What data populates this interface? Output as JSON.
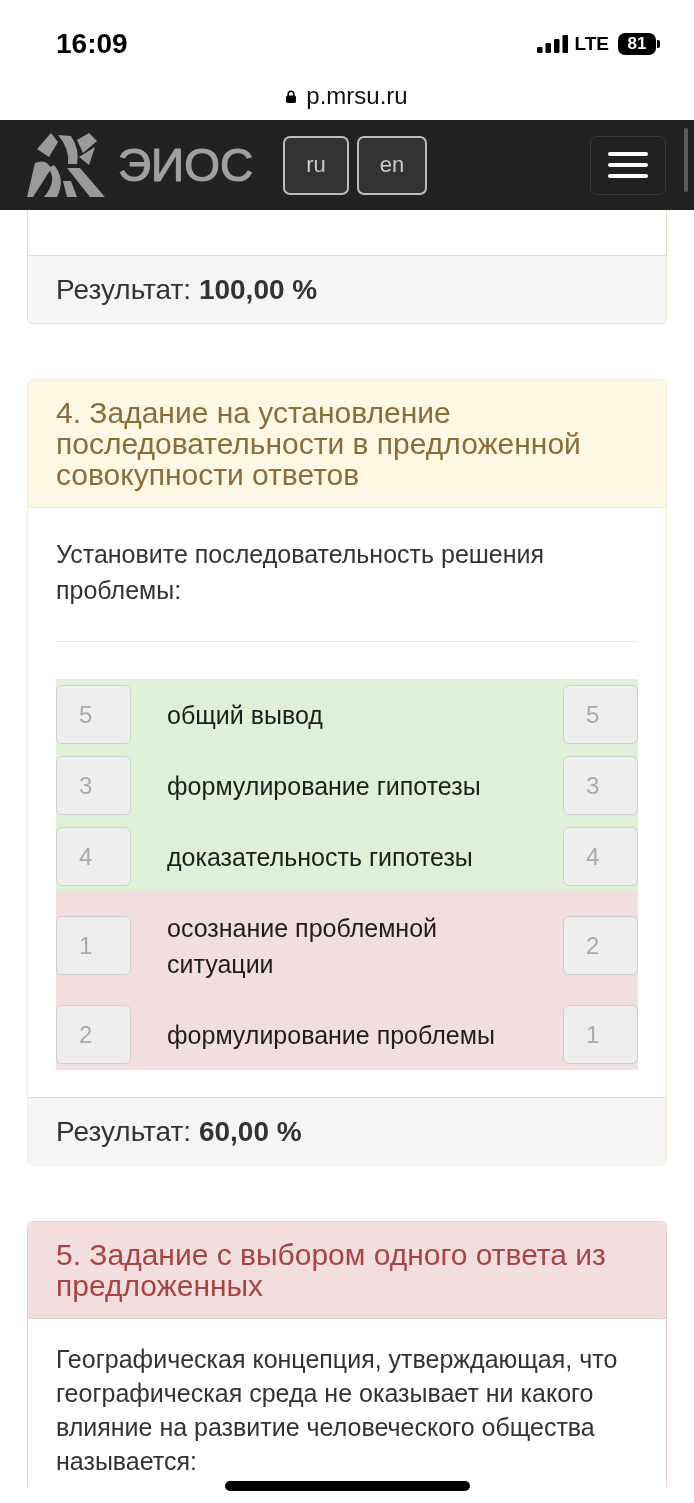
{
  "status_bar": {
    "time": "16:09",
    "network": "LTE",
    "battery": "81"
  },
  "address_bar": {
    "url": "p.mrsu.ru"
  },
  "navbar": {
    "brand": "ЭИОС",
    "languages": [
      {
        "label": "ru"
      },
      {
        "label": "en"
      }
    ]
  },
  "panels": [
    {
      "kind": "success",
      "result": "Результат: **100,00 %**"
    },
    {
      "kind": "warning",
      "title": "4. Задание на установление последовательности в предложенной совокупности ответов",
      "question": "Установите последовательность решения проблемы:",
      "answers": [
        {
          "order": "5",
          "text": "общий вывод",
          "correct_order": "5",
          "correct": true
        },
        {
          "order": "3",
          "text": "формулирование гипотезы",
          "correct_order": "3",
          "correct": true
        },
        {
          "order": "4",
          "text": "доказательность гипотезы",
          "correct_order": "4",
          "correct": true
        },
        {
          "order": "1",
          "text": "осознание проблемной ситуации",
          "correct_order": "2",
          "correct": false
        },
        {
          "order": "2",
          "text": "формулирование проблемы",
          "correct_order": "1",
          "correct": false
        }
      ],
      "result": "Результат: **60,00 %**"
    },
    {
      "kind": "danger",
      "title": "5. Задание с выбором одного ответа из предложенных",
      "question": "Географическая концепция, утверждающая, что географическая среда не оказывает ни какого влияние на развитие человеческого общества называется:"
    }
  ]
}
